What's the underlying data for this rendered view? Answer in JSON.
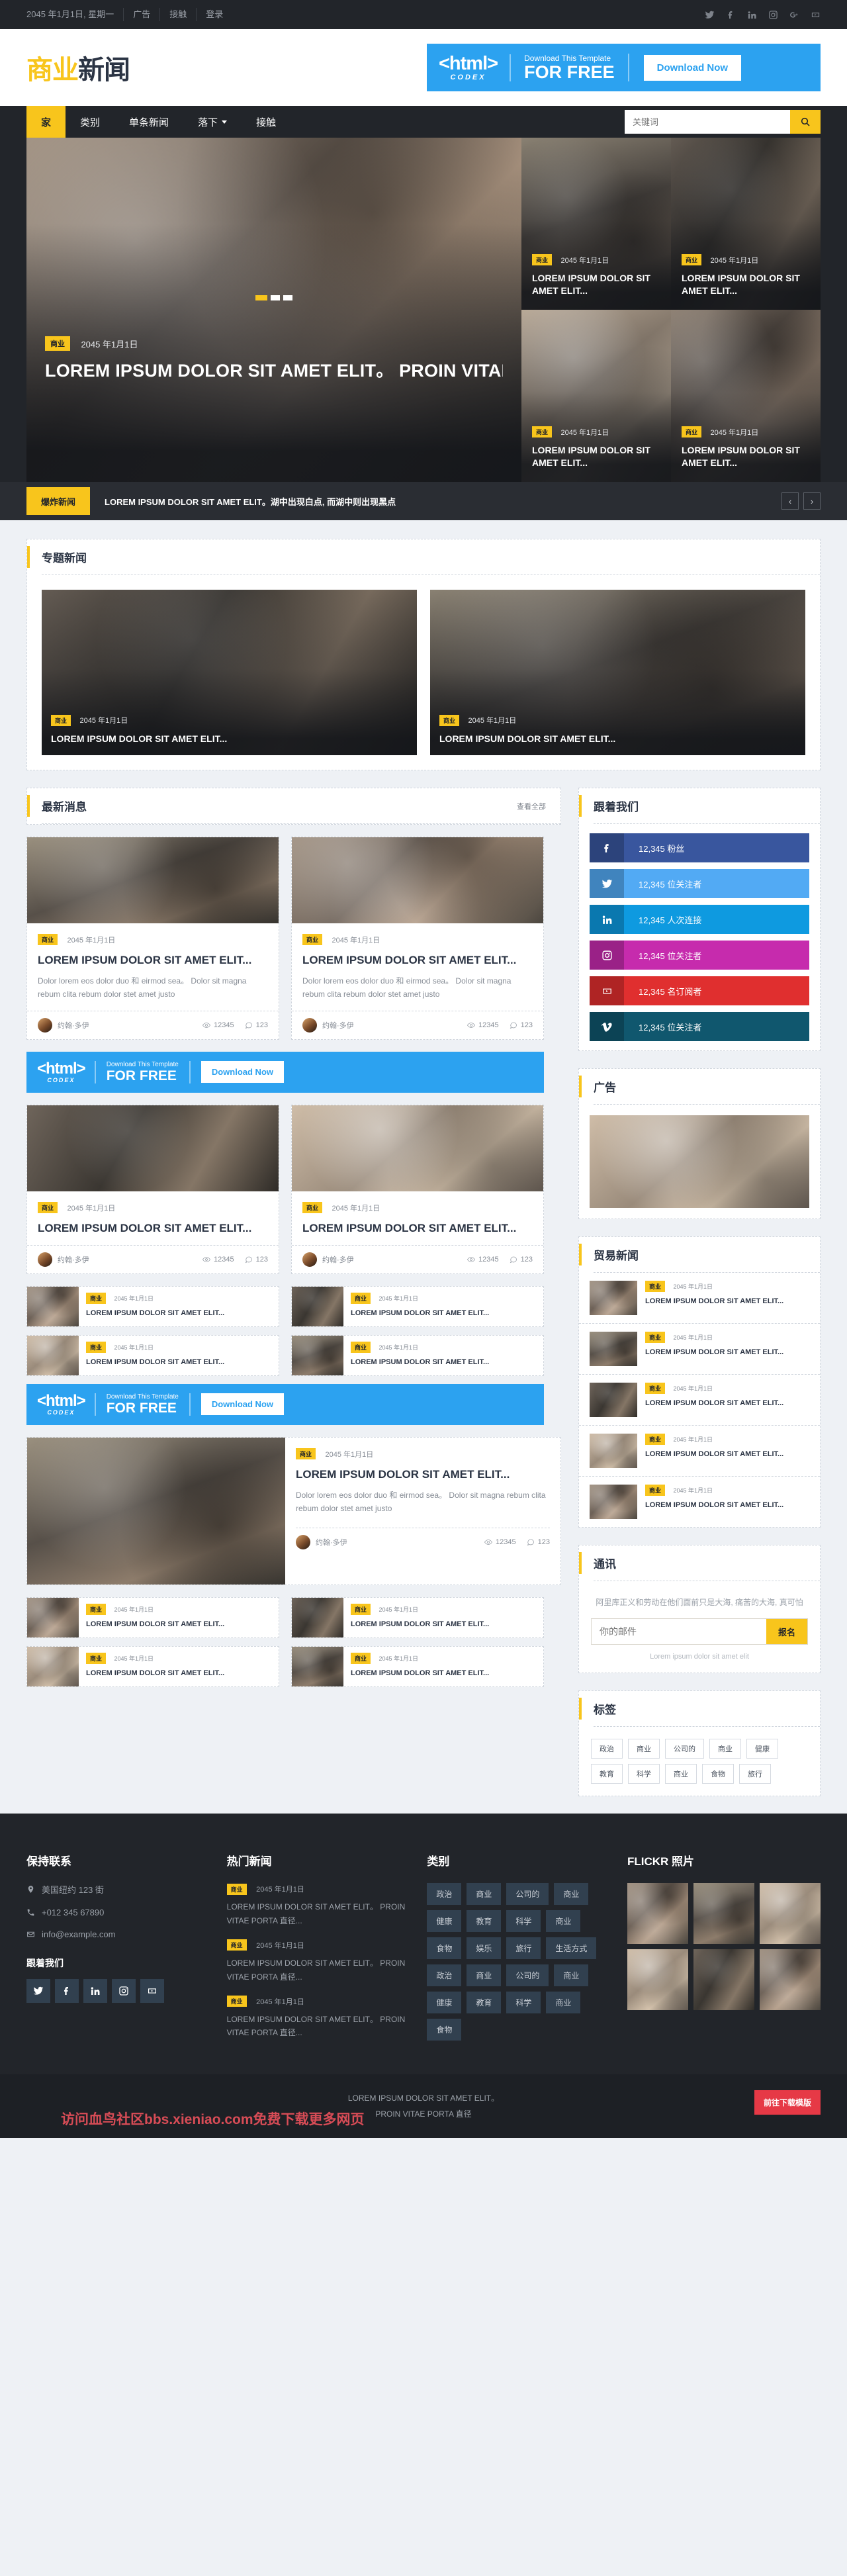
{
  "topbar": {
    "date": "2045 年1月1日, 星期一",
    "links": [
      "广告",
      "接触",
      "登录"
    ],
    "socials": [
      "twitter-icon",
      "facebook-icon",
      "linkedin-icon",
      "instagram-icon",
      "googleplus-icon",
      "youtube-icon"
    ]
  },
  "header": {
    "logo_accent": "商业",
    "logo_rest": "新闻",
    "ad": {
      "brand": "<html>",
      "brand_sub": "CODEX",
      "line1": "Download This Template",
      "line2": "FOR FREE",
      "button": "Download Now"
    }
  },
  "nav": {
    "items": [
      {
        "label": "家",
        "active": true,
        "dropdown": false
      },
      {
        "label": "类别",
        "active": false,
        "dropdown": false
      },
      {
        "label": "单条新闻",
        "active": false,
        "dropdown": false
      },
      {
        "label": "落下",
        "active": false,
        "dropdown": true
      },
      {
        "label": "接触",
        "active": false,
        "dropdown": false
      }
    ],
    "search_placeholder": "关键词",
    "search_value": ""
  },
  "hero": {
    "main": {
      "category": "商业",
      "date": "2045 年1月1日",
      "title": "LOREM IPSUM DOLOR SIT AMET ELIT。 PROIN VITAE PORTA 直径"
    },
    "tiles": [
      {
        "category": "商业",
        "date": "2045 年1月1日",
        "title": "LOREM IPSUM DOLOR SIT AMET ELIT..."
      },
      {
        "category": "商业",
        "date": "2045 年1月1日",
        "title": "LOREM IPSUM DOLOR SIT AMET ELIT..."
      },
      {
        "category": "商业",
        "date": "2045 年1月1日",
        "title": "LOREM IPSUM DOLOR SIT AMET ELIT..."
      },
      {
        "category": "商业",
        "date": "2045 年1月1日",
        "title": "LOREM IPSUM DOLOR SIT AMET ELIT..."
      }
    ],
    "breaking": {
      "label": "爆炸新闻",
      "text": "LOREM IPSUM DOLOR SIT AMET ELIT。湖中出现白点, 而湖中则出现黑点",
      "prev": "‹",
      "next": "›"
    }
  },
  "featured": {
    "title": "专题新闻",
    "items": [
      {
        "category": "商业",
        "date": "2045 年1月1日",
        "title": "LOREM IPSUM DOLOR SIT AMET ELIT..."
      },
      {
        "category": "商业",
        "date": "2045 年1月1日",
        "title": "LOREM IPSUM DOLOR SIT AMET ELIT..."
      }
    ]
  },
  "latest": {
    "title": "最新消息",
    "more": "查看全部",
    "articles": [
      {
        "category": "商业",
        "date": "2045 年1月1日",
        "title": "LOREM IPSUM DOLOR SIT AMET ELIT...",
        "desc": "Dolor lorem eos dolor duo 和 eirmod sea。 Dolor sit magna rebum clita rebum dolor stet amet justo",
        "author": "约翰·多伊",
        "views": "12345",
        "comments": "123"
      },
      {
        "category": "商业",
        "date": "2045 年1月1日",
        "title": "LOREM IPSUM DOLOR SIT AMET ELIT...",
        "desc": "Dolor lorem eos dolor duo 和 eirmod sea。 Dolor sit magna rebum clita rebum dolor stet amet justo",
        "author": "约翰·多伊",
        "views": "12345",
        "comments": "123"
      },
      {
        "category": "商业",
        "date": "2045 年1月1日",
        "title": "LOREM IPSUM DOLOR SIT AMET ELIT...",
        "desc": "",
        "author": "约翰·多伊",
        "views": "12345",
        "comments": "123"
      },
      {
        "category": "商业",
        "date": "2045 年1月1日",
        "title": "LOREM IPSUM DOLOR SIT AMET ELIT...",
        "desc": "",
        "author": "约翰·多伊",
        "views": "12345",
        "comments": "123"
      }
    ],
    "small_items": [
      {
        "category": "商业",
        "date": "2045 年1月1日",
        "title": "LOREM IPSUM DOLOR SIT AMET ELIT..."
      },
      {
        "category": "商业",
        "date": "2045 年1月1日",
        "title": "LOREM IPSUM DOLOR SIT AMET ELIT..."
      },
      {
        "category": "商业",
        "date": "2045 年1月1日",
        "title": "LOREM IPSUM DOLOR SIT AMET ELIT..."
      },
      {
        "category": "商业",
        "date": "2045 年1月1日",
        "title": "LOREM IPSUM DOLOR SIT AMET ELIT..."
      }
    ],
    "big_feature": {
      "category": "商业",
      "date": "2045 年1月1日",
      "title": "LOREM IPSUM DOLOR SIT AMET ELIT...",
      "desc": "Dolor lorem eos dolor duo 和 eirmod sea。 Dolor sit magna rebum clita rebum dolor stet amet justo",
      "author": "约翰·多伊",
      "views": "12345",
      "comments": "123"
    },
    "bottom_items": [
      {
        "category": "商业",
        "date": "2045 年1月1日",
        "title": "LOREM IPSUM DOLOR SIT AMET ELIT..."
      },
      {
        "category": "商业",
        "date": "2045 年1月1日",
        "title": "LOREM IPSUM DOLOR SIT AMET ELIT..."
      },
      {
        "category": "商业",
        "date": "2045 年1月1日",
        "title": "LOREM IPSUM DOLOR SIT AMET ELIT..."
      },
      {
        "category": "商业",
        "date": "2045 年1月1日",
        "title": "LOREM IPSUM DOLOR SIT AMET ELIT..."
      }
    ]
  },
  "follow": {
    "title": "跟着我们",
    "items": [
      {
        "icon": "facebook-icon",
        "label": "12,345 粉丝",
        "color": "#39569e"
      },
      {
        "icon": "twitter-icon",
        "label": "12,345 位关注者",
        "color": "#52aaf4"
      },
      {
        "icon": "linkedin-icon",
        "label": "12,345 人次连接",
        "color": "#0e9ae0"
      },
      {
        "icon": "instagram-icon",
        "label": "12,345 位关注者",
        "color": "#c62bad"
      },
      {
        "icon": "youtube-icon",
        "label": "12,345 名订阅者",
        "color": "#e02f2f"
      },
      {
        "icon": "vimeo-icon",
        "label": "12,345 位关注者",
        "color": "#10576e"
      }
    ]
  },
  "sidebar_ad": {
    "title": "广告"
  },
  "trade_news": {
    "title": "贸易新闻",
    "items": [
      {
        "category": "商业",
        "date": "2045 年1月1日",
        "title": "LOREM IPSUM DOLOR SIT AMET ELIT..."
      },
      {
        "category": "商业",
        "date": "2045 年1月1日",
        "title": "LOREM IPSUM DOLOR SIT AMET ELIT..."
      },
      {
        "category": "商业",
        "date": "2045 年1月1日",
        "title": "LOREM IPSUM DOLOR SIT AMET ELIT..."
      },
      {
        "category": "商业",
        "date": "2045 年1月1日",
        "title": "LOREM IPSUM DOLOR SIT AMET ELIT..."
      },
      {
        "category": "商业",
        "date": "2045 年1月1日",
        "title": "LOREM IPSUM DOLOR SIT AMET ELIT..."
      }
    ]
  },
  "newsletter": {
    "title": "通讯",
    "desc": "阿里库正义和劳动在他们面前只是大海, 痛苦的大海, 真可怕",
    "placeholder": "你的邮件",
    "value": "",
    "button": "报名",
    "note": "Lorem ipsum dolor sit amet elit"
  },
  "tags_widget": {
    "title": "标签",
    "tags": [
      "政治",
      "商业",
      "公司的",
      "商业",
      "健康",
      "教育",
      "科学",
      "商业",
      "食物",
      "旅行"
    ]
  },
  "footer": {
    "contact": {
      "title": "保持联系",
      "address": "美国纽约 123 街",
      "phone": "+012 345 67890",
      "email": "info@example.com",
      "follow_title": "跟着我们",
      "socials": [
        "twitter-icon",
        "facebook-icon",
        "linkedin-icon",
        "instagram-icon",
        "youtube-icon"
      ]
    },
    "popular": {
      "title": "热门新闻",
      "items": [
        {
          "category": "商业",
          "date": "2045 年1月1日",
          "text": "LOREM IPSUM DOLOR SIT AMET ELIT。 PROIN VITAE PORTA 直径..."
        },
        {
          "category": "商业",
          "date": "2045 年1月1日",
          "text": "LOREM IPSUM DOLOR SIT AMET ELIT。 PROIN VITAE PORTA 直径..."
        },
        {
          "category": "商业",
          "date": "2045 年1月1日",
          "text": "LOREM IPSUM DOLOR SIT AMET ELIT。 PROIN VITAE PORTA 直径..."
        }
      ]
    },
    "categories": {
      "title": "类别",
      "items": [
        "政治",
        "商业",
        "公司的",
        "商业",
        "健康",
        "教育",
        "科学",
        "商业",
        "食物",
        "娱乐",
        "旅行",
        "生活方式",
        "政治",
        "商业",
        "公司的",
        "商业",
        "健康",
        "教育",
        "科学",
        "商业",
        "食物"
      ]
    },
    "flickr": {
      "title": "FLICKR 照片",
      "count": 6
    }
  },
  "bottombar": {
    "line1": "LOREM IPSUM DOLOR SIT AMET ELIT。",
    "line2": "PROIN VITAE PORTA 直径",
    "download_badge": "前往下载模版",
    "watermark": "访问血鸟社区bbs.xieniao.com免费下载更多网页"
  }
}
